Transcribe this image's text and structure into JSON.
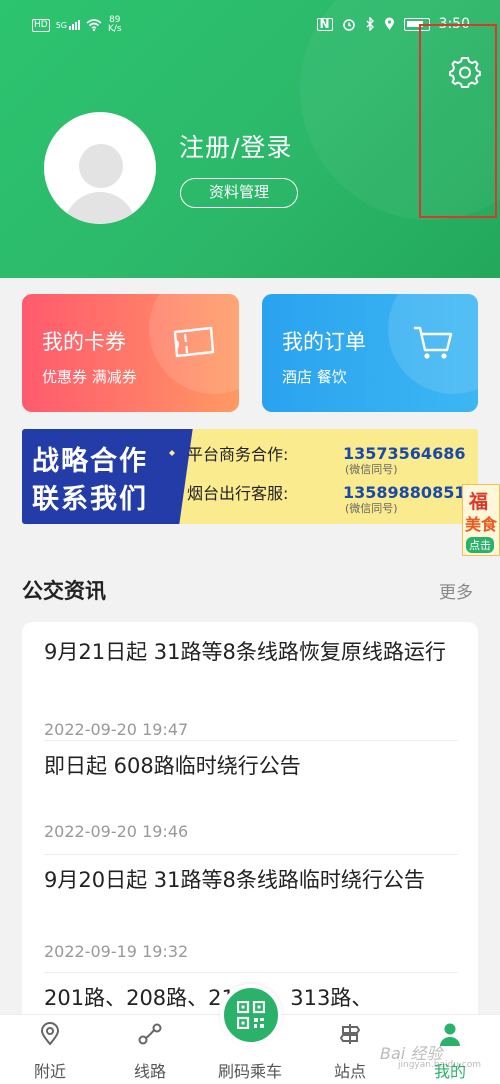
{
  "status_bar": {
    "net_tag": "HD",
    "signal_tag": "5G",
    "speed_value": "89",
    "speed_unit": "K/s",
    "time": "3:50"
  },
  "profile": {
    "login_text": "注册/登录",
    "manage_button": "资料管理"
  },
  "cards": {
    "coupon": {
      "title": "我的卡券",
      "subtitle": "优惠券  满减券"
    },
    "order": {
      "title": "我的订单",
      "subtitle": "酒店  餐饮"
    }
  },
  "banner": {
    "line1": "战略合作",
    "line2": "联系我们",
    "rows": [
      {
        "label": "平台商务合作:",
        "number": "13573564686",
        "note": "(微信同号)"
      },
      {
        "label": "烟台出行客服:",
        "number": "13589880851",
        "note": "(微信同号)"
      }
    ]
  },
  "side_ad": {
    "line1": "福",
    "line2": "美食",
    "line3": "点击"
  },
  "news": {
    "section_title": "公交资讯",
    "more": "更多",
    "items": [
      {
        "title": "9月21日起 31路等8条线路恢复原线路运行",
        "date": "2022-09-20 19:47"
      },
      {
        "title": "即日起 608路临时绕行公告",
        "date": "2022-09-20 19:46"
      },
      {
        "title": "9月20日起 31路等8条线路临时绕行公告",
        "date": "2022-09-19 19:32"
      },
      {
        "title": "201路、208路、215路、313路、",
        "date": ""
      }
    ]
  },
  "tabs": [
    {
      "label": "附近",
      "icon": "location-pin-icon"
    },
    {
      "label": "线路",
      "icon": "route-icon"
    },
    {
      "label": "刷码乘车",
      "icon": "qr-code-icon"
    },
    {
      "label": "站点",
      "icon": "station-sign-icon"
    },
    {
      "label": "我的",
      "icon": "person-icon"
    }
  ],
  "watermark": {
    "main": "Bai 经验",
    "sub": "jingyan.baidu.com"
  },
  "colors": {
    "brand_green": "#2bb26a",
    "highlight_red": "#d8382f",
    "banner_blue": "#243ca8"
  }
}
